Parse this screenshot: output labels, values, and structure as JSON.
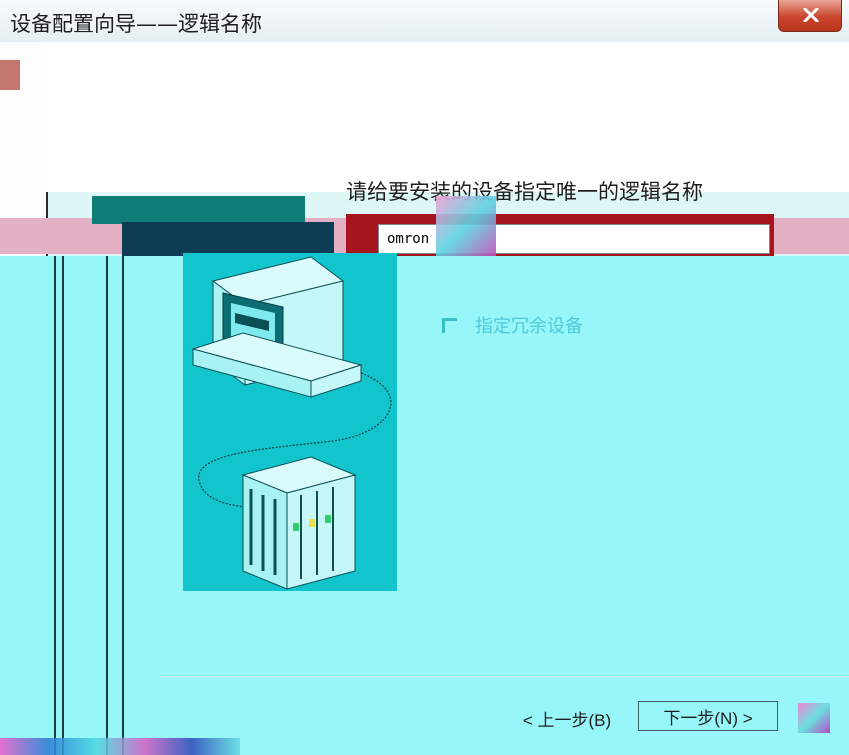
{
  "window": {
    "title": "设备配置向导——逻辑名称"
  },
  "form": {
    "prompt": "请给要安装的设备指定唯一的逻辑名称",
    "name_value": "omron",
    "checkbox_label": "指定冗余设备"
  },
  "buttons": {
    "back_label": "< 上一步(B)",
    "next_label": "下一步(N) >"
  },
  "icons": {
    "close": "close-icon",
    "computer": "computer-icon",
    "plc": "plc-device-icon"
  },
  "colors": {
    "main_background": "#96f6f8",
    "illustration_background": "#12c4cc",
    "close_button": "#c9452d"
  }
}
